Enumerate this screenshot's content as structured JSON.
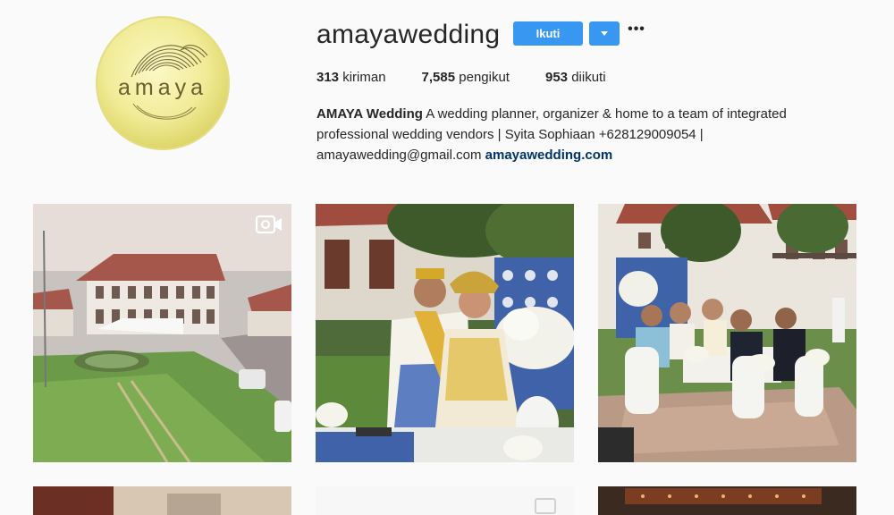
{
  "profile": {
    "avatar_text": "amaya",
    "username": "amayawedding",
    "follow_label": "Ikuti",
    "more_label": "•••",
    "stats": [
      {
        "count": "313",
        "label": "kiriman"
      },
      {
        "count": "7,585",
        "label": "pengikut"
      },
      {
        "count": "953",
        "label": "diikuti"
      }
    ],
    "bio": {
      "name": "AMAYA Wedding",
      "text": " A wedding planner, organizer & home to a team of integrated professional wedding vendors | Syita Sophiaan +628129009054 | amayawedding@gmail.com ",
      "link": "amayawedding.com"
    }
  },
  "icons": {
    "video": "video-camera-icon",
    "dropdown": "chevron-down-icon",
    "more": "more-options-icon"
  },
  "colors": {
    "accent": "#3897f0",
    "link": "#003569",
    "avatar": "#ece68a"
  }
}
